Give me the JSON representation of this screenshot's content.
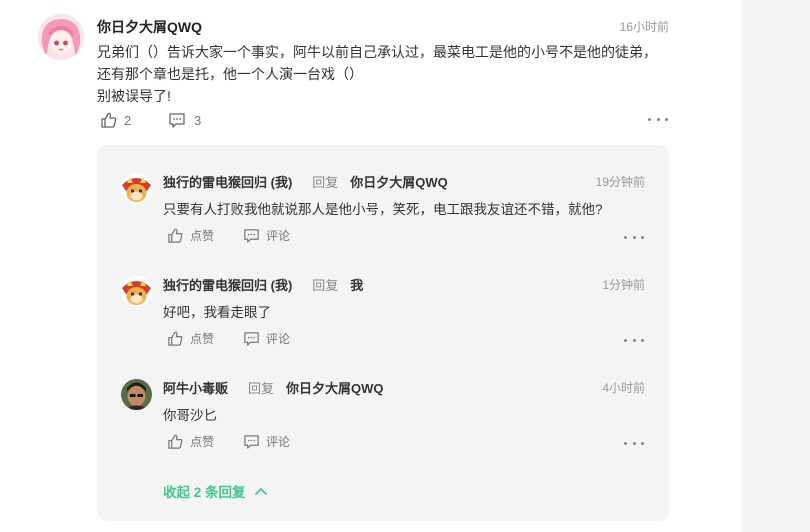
{
  "comment": {
    "author": "你日夕大屑QWQ",
    "time": "16小时前",
    "lines": [
      "兄弟们（）告诉大家一个事实，阿牛以前自己承认过，最菜电工是他的小号不是他的徒弟，",
      "还有那个章也是托，他一个人演一台戏（）",
      "别被误导了!"
    ],
    "like_count": "2",
    "comment_count": "3"
  },
  "replies": [
    {
      "author": "独行的雷电猴回归 (我)",
      "reply_word": "回复",
      "target": "你日夕大屑QWQ",
      "time": "19分钟前",
      "text": "只要有人打败我他就说那人是他小号，笑死，电工跟我友谊还不错，就他?",
      "like_label": "点赞",
      "comment_label": "评论"
    },
    {
      "author": "独行的雷电猴回归 (我)",
      "reply_word": "回复",
      "target": "我",
      "time": "1分钟前",
      "text": "好吧，我看走眼了",
      "like_label": "点赞",
      "comment_label": "评论"
    },
    {
      "author": "阿牛小毒贩",
      "reply_word": "回复",
      "target": "你日夕大屑QWQ",
      "time": "4小时前",
      "text": "你哥沙匕",
      "like_label": "点赞",
      "comment_label": "评论"
    }
  ],
  "collapse_label": "收起 2 条回复",
  "colors": {
    "accent_green": "#3fc88c",
    "reply_bg": "#f4f4f4"
  },
  "icons": [
    "thumbs-up-icon",
    "comment-icon",
    "more-icon",
    "chevron-up-icon"
  ]
}
